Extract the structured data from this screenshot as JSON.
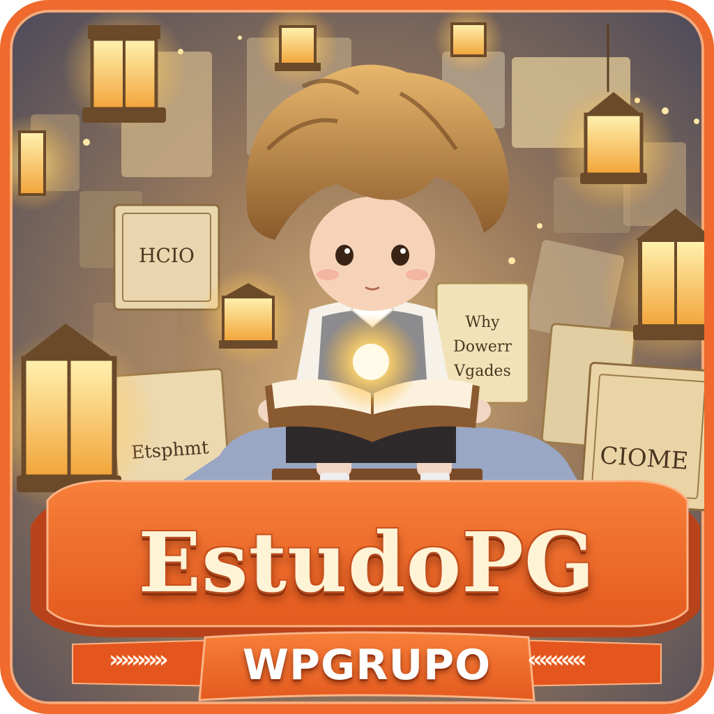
{
  "brand": {
    "title": "EstudoPG",
    "subtitle": "WPGRUPO",
    "left_chevrons": "»»»»»",
    "right_chevrons": "«««««"
  },
  "illustration": {
    "book_texts": [
      "HCIO",
      "Why Dowerr Vgades",
      "Etsphmt",
      "CIOME"
    ]
  },
  "colors": {
    "frame": "#ef6a2c",
    "banner": "#ef6a2c",
    "banner_dark": "#b8431a",
    "title_fill": "#fff3d6",
    "lantern_glow": "#ffd36a"
  },
  "icons": [
    "lantern-icon",
    "open-book-icon",
    "chevron-right-icon",
    "chevron-left-icon"
  ]
}
